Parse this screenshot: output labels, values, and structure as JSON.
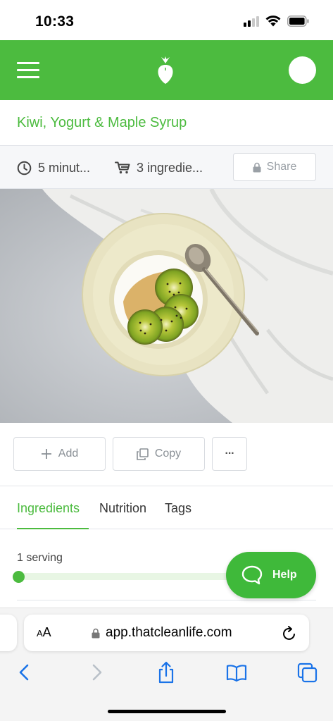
{
  "status_bar": {
    "time": "10:33"
  },
  "header": {
    "brand_color": "#4cbb3f",
    "menu_icon": "hamburger-menu-icon",
    "logo_icon": "strawberry-logo-icon",
    "avatar_icon": "user-avatar"
  },
  "recipe": {
    "title": "Kiwi, Yogurt & Maple Syrup",
    "time": "5 minut...",
    "ingredients_count": "3 ingredie...",
    "share_label": "Share",
    "photo_alt": "Kiwi, Yogurt & Maple Syrup"
  },
  "actions": {
    "add_label": "Add",
    "copy_label": "Copy",
    "more_label": "···"
  },
  "tabs": [
    {
      "label": "Ingredients",
      "active": true
    },
    {
      "label": "Nutrition",
      "active": false
    },
    {
      "label": "Tags",
      "active": false
    }
  ],
  "servings": {
    "label": "1 serving",
    "slider_value": 1
  },
  "help": {
    "label": "Help"
  },
  "browser": {
    "aa_small": "A",
    "aa_large": "A",
    "url": "app.thatcleanlife.com"
  }
}
